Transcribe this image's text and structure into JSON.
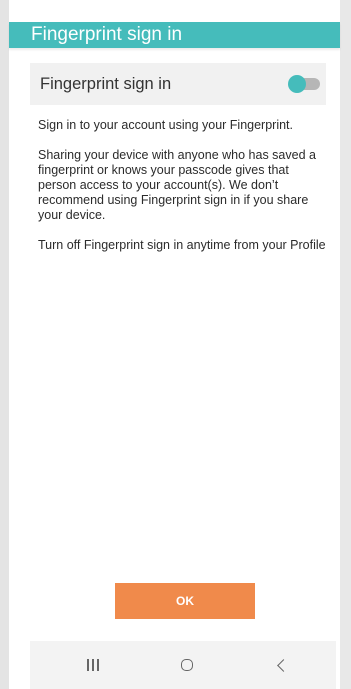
{
  "header": {
    "title": "Fingerprint sign in"
  },
  "setting": {
    "label": "Fingerprint sign in",
    "toggle_state": "on",
    "accent_color": "#45bcbb"
  },
  "content": {
    "paragraphs": [
      "Sign in to your account using your Fingerprint.",
      "Sharing your device with anyone who has saved a fingerprint or knows your passcode gives that person access to your account(s). We don’t recommend using Fingerprint sign in if you share your device.",
      "Turn off Fingerprint sign in anytime from your Profile"
    ]
  },
  "actions": {
    "ok_label": "OK",
    "ok_color": "#f08a4b"
  },
  "navbar": {
    "recents_icon": "recents-icon",
    "home_icon": "home-icon",
    "back_icon": "back-icon"
  }
}
